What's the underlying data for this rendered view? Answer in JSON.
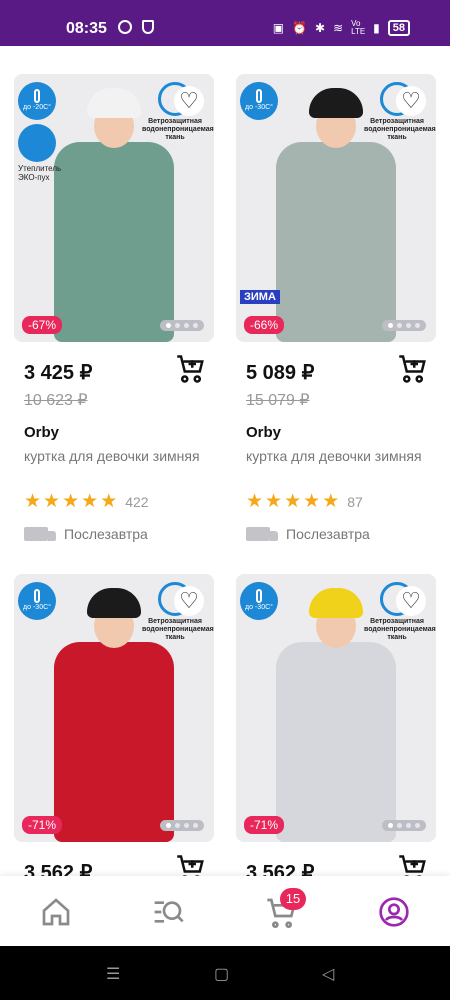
{
  "status": {
    "time": "08:35",
    "network": "Vo LTE",
    "battery": "58"
  },
  "products": [
    {
      "price": "3 425 ₽",
      "old_price": "10 623 ₽",
      "brand": "Orby",
      "desc": "куртка для девочки зимняя",
      "rating_count": "422",
      "delivery": "Послезавтра",
      "discount": "-67%",
      "temp_badge": "до -20С°",
      "eco_label": "Утеплитель ЭКО-пух",
      "wind_label": "Ветрозащитная водонепроницаемая ткань",
      "coat_color": "#6f9e8e",
      "hat_color": "#f2f2f2"
    },
    {
      "price": "5 089 ₽",
      "old_price": "15 079 ₽",
      "brand": "Orby",
      "desc": "куртка для девочки зимняя",
      "rating_count": "87",
      "delivery": "Послезавтра",
      "discount": "-66%",
      "temp_badge": "до -30С°",
      "wind_label": "Ветрозащитная водонепроницаемая ткань",
      "zima_label": "ЗИМА",
      "coat_color": "#a6b4b0",
      "hat_color": "#1b1b1b"
    },
    {
      "price": "3 562 ₽",
      "discount": "-71%",
      "temp_badge": "до -30С°",
      "wind_label": "Ветрозащитная водонепроницаемая ткань",
      "coat_color": "#c8182a",
      "hat_color": "#1b1b1b"
    },
    {
      "price": "3 562 ₽",
      "discount": "-71%",
      "temp_badge": "до -30С°",
      "wind_label": "Ветрозащитная водонепроницаемая ткань",
      "coat_color": "#d6d7dc",
      "hat_color": "#f1d21a"
    }
  ],
  "tabbar": {
    "cart_count": "15"
  },
  "colors": {
    "accent": "#5a1a86",
    "discount": "#e8275a",
    "star": "#f4a81a",
    "badge_blue": "#1c88d6"
  }
}
